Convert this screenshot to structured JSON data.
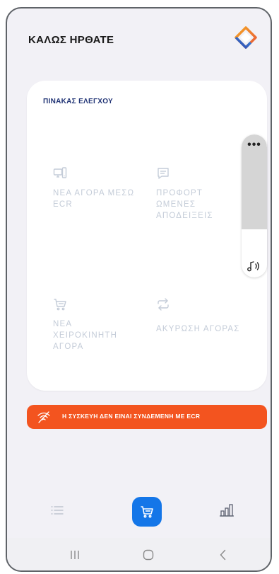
{
  "header": {
    "title": "ΚΑΛΩΣ ΗΡΘΑΤΕ",
    "logo_icon": "diamond-logo-icon"
  },
  "dashboard": {
    "title": "ΠΙΝΑΚΑΣ ΕΛΕΓΧΟΥ",
    "tiles": [
      {
        "label": "ΝΕΑ ΑΓΟΡΑ ΜΕΣΩ ECR",
        "icon": "devices-icon"
      },
      {
        "label": "ΠΡΟΦΟΡΤ ΩΜΕΝΕΣ ΑΠΟΔΕΙΞΕΙΣ",
        "icon": "receipt-icon"
      },
      {
        "label": "ΝΕΑ ΧΕΙΡΟΚΙΝΗΤΗ ΑΓΟΡΑ",
        "icon": "cart-icon"
      },
      {
        "label": "ΑΚΥΡΩΣΗ ΑΓΟΡΑΣ",
        "icon": "repeat-icon"
      }
    ]
  },
  "scroller": {
    "more": "•••",
    "icon": "sound-icon"
  },
  "banner": {
    "text": "Η ΣΥΣΚΕΥΗ ΔΕΝ ΕΙΝΑΙ ΣΥΝΔΕΜΕΝΗ ΜΕ ECR",
    "icon": "no-wifi-icon",
    "color": "#f3541f"
  },
  "nav": {
    "items": [
      "list-icon",
      "cart-icon",
      "bar-chart-icon"
    ],
    "active": "cart-icon",
    "accent": "#1476e8"
  },
  "system_nav": [
    "recent-apps-icon",
    "home-icon",
    "back-icon"
  ]
}
